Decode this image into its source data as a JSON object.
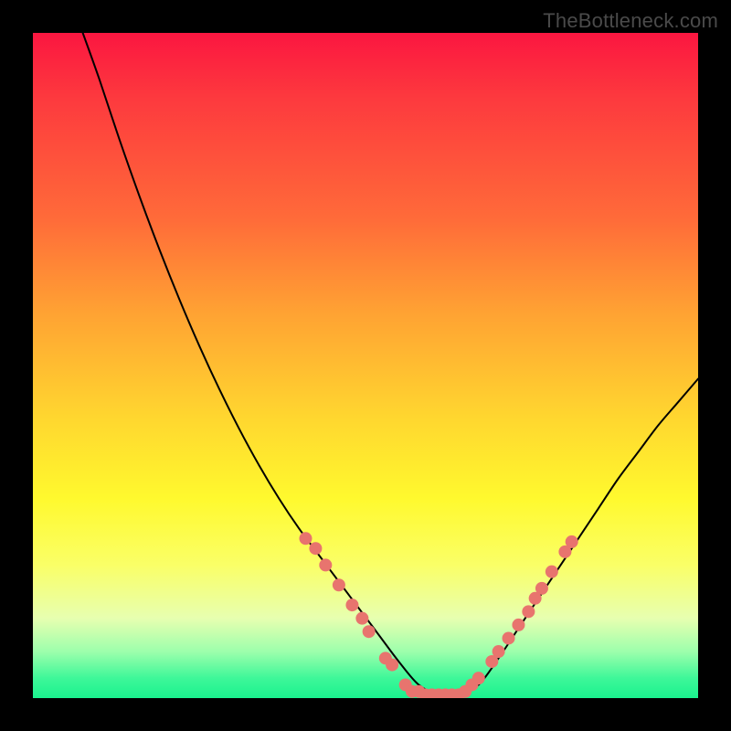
{
  "watermark": "TheBottleneck.com",
  "chart_data": {
    "type": "line",
    "title": "",
    "xlabel": "",
    "ylabel": "",
    "xlim": [
      0,
      100
    ],
    "ylim": [
      0,
      100
    ],
    "grid": false,
    "legend": false,
    "background_gradient": {
      "direction": "vertical",
      "stops": [
        {
          "pos": 0.0,
          "color": "#fb1640"
        },
        {
          "pos": 0.1,
          "color": "#fd3a3e"
        },
        {
          "pos": 0.28,
          "color": "#ff6b39"
        },
        {
          "pos": 0.42,
          "color": "#ffa233"
        },
        {
          "pos": 0.58,
          "color": "#ffd72f"
        },
        {
          "pos": 0.7,
          "color": "#fff92e"
        },
        {
          "pos": 0.8,
          "color": "#faff67"
        },
        {
          "pos": 0.88,
          "color": "#e7ffb0"
        },
        {
          "pos": 0.93,
          "color": "#9dffac"
        },
        {
          "pos": 0.97,
          "color": "#3ef799"
        },
        {
          "pos": 1.0,
          "color": "#1af28e"
        }
      ]
    },
    "series": [
      {
        "name": "bottleneck-curve",
        "color": "#000000",
        "stroke_width": 2,
        "x": [
          7.5,
          10,
          13,
          16,
          19,
          22,
          25,
          28,
          31,
          34,
          37,
          40,
          43,
          46,
          49,
          52,
          55,
          58,
          61,
          64,
          67,
          70,
          73,
          76,
          79,
          82,
          85,
          88,
          91,
          94,
          97,
          100
        ],
        "y": [
          100,
          93,
          84,
          75.5,
          67.5,
          60,
          53,
          46.5,
          40.5,
          35,
          30,
          25.5,
          21.5,
          17.5,
          13.5,
          9.5,
          5.5,
          2,
          0.5,
          0.5,
          2,
          6,
          10.5,
          15,
          19.5,
          24,
          28.5,
          33,
          37,
          41,
          44.5,
          48
        ]
      }
    ],
    "markers": [
      {
        "name": "highlight-points",
        "color": "#e8746e",
        "radius_px": 7,
        "points": [
          {
            "x": 41,
            "y": 24
          },
          {
            "x": 42.5,
            "y": 22.5
          },
          {
            "x": 44,
            "y": 20
          },
          {
            "x": 46,
            "y": 17
          },
          {
            "x": 48,
            "y": 14
          },
          {
            "x": 49.5,
            "y": 12
          },
          {
            "x": 50.5,
            "y": 10
          },
          {
            "x": 53,
            "y": 6
          },
          {
            "x": 54,
            "y": 5
          },
          {
            "x": 56,
            "y": 2
          },
          {
            "x": 57,
            "y": 1
          },
          {
            "x": 58,
            "y": 1
          },
          {
            "x": 59,
            "y": 0.5
          },
          {
            "x": 60,
            "y": 0.5
          },
          {
            "x": 61,
            "y": 0.5
          },
          {
            "x": 62,
            "y": 0.5
          },
          {
            "x": 63,
            "y": 0.5
          },
          {
            "x": 64,
            "y": 0.5
          },
          {
            "x": 65,
            "y": 1
          },
          {
            "x": 66,
            "y": 2
          },
          {
            "x": 67,
            "y": 3
          },
          {
            "x": 69,
            "y": 5.5
          },
          {
            "x": 70,
            "y": 7
          },
          {
            "x": 71.5,
            "y": 9
          },
          {
            "x": 73,
            "y": 11
          },
          {
            "x": 74.5,
            "y": 13
          },
          {
            "x": 75.5,
            "y": 15
          },
          {
            "x": 76.5,
            "y": 16.5
          },
          {
            "x": 78,
            "y": 19
          },
          {
            "x": 80,
            "y": 22
          },
          {
            "x": 81,
            "y": 23.5
          }
        ]
      }
    ]
  }
}
